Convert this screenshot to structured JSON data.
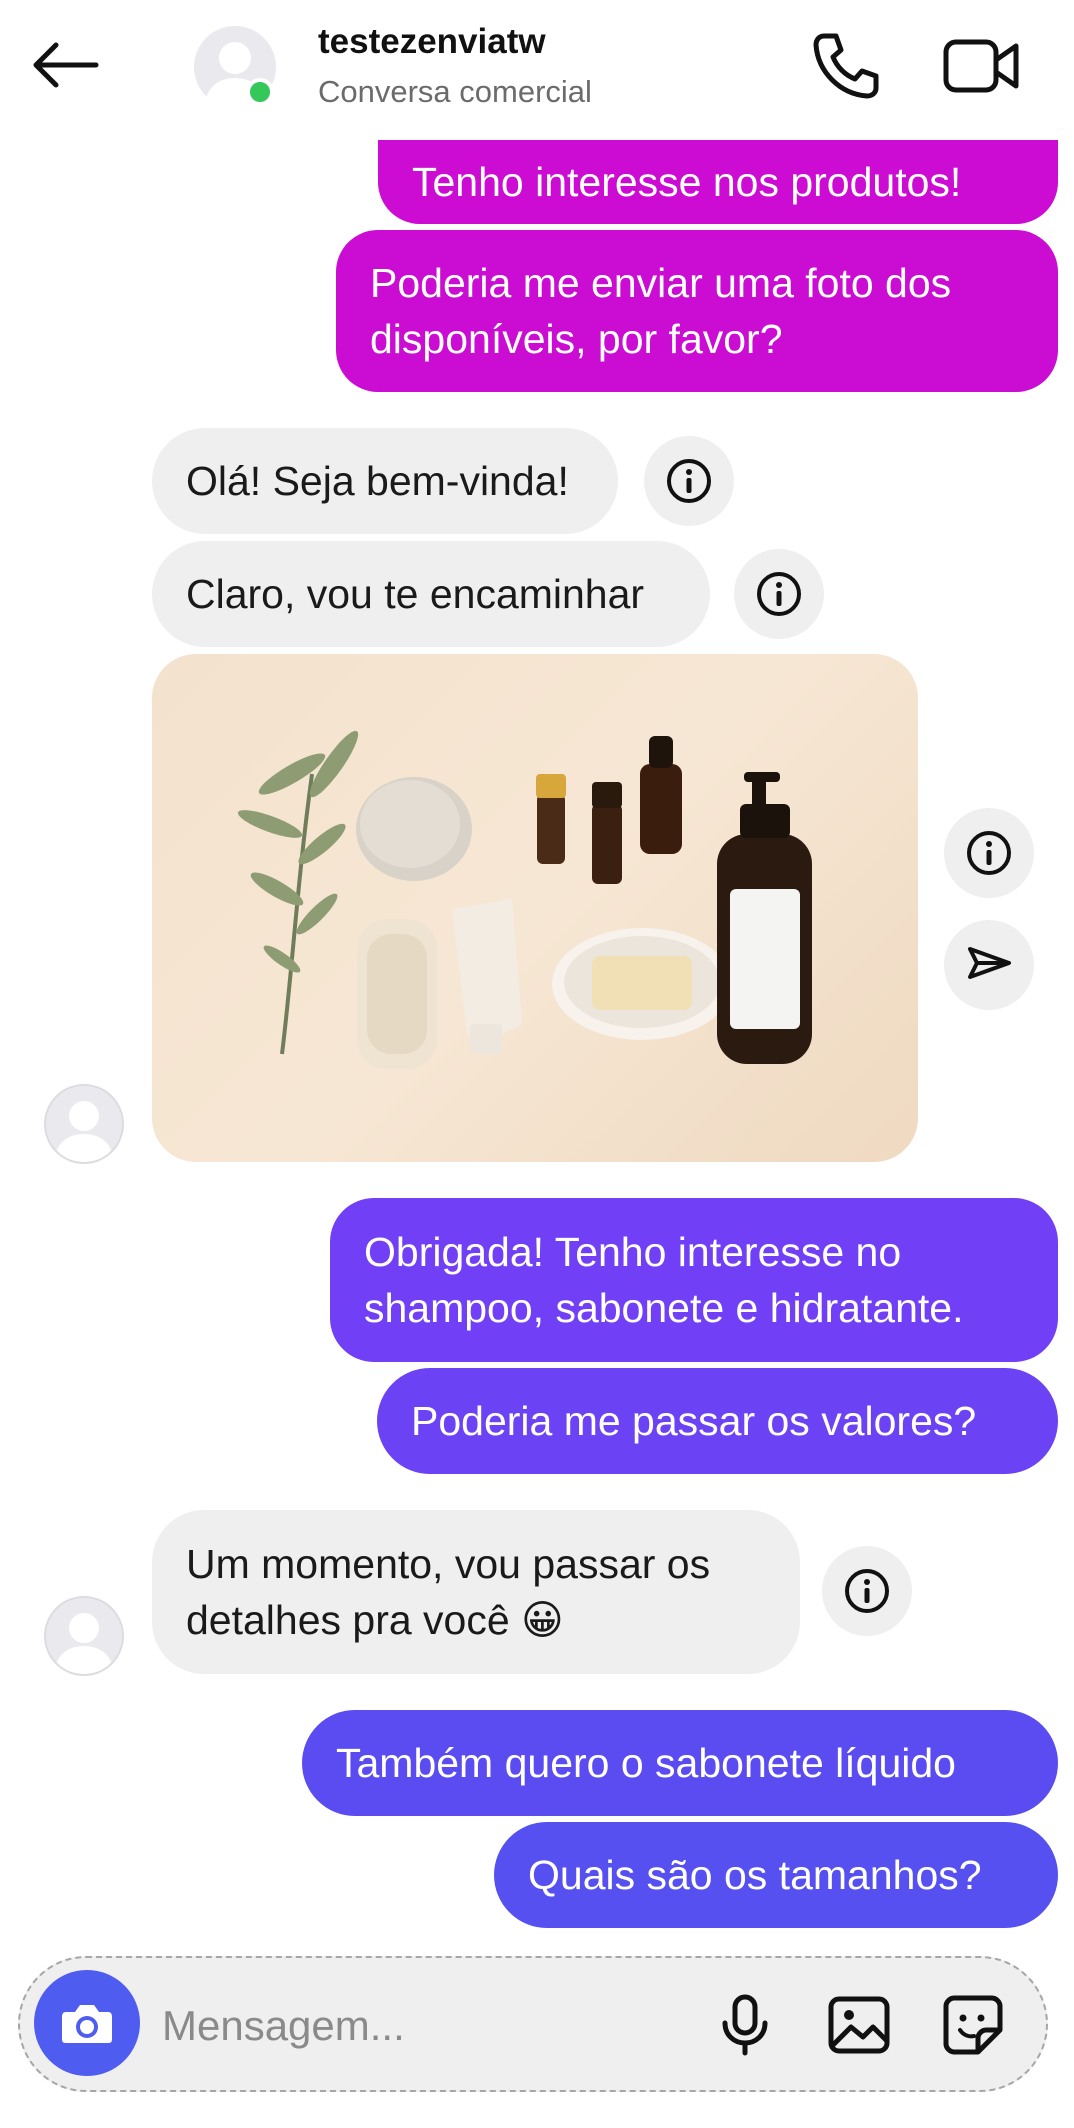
{
  "header": {
    "contact_name": "testezenviatw",
    "contact_subtitle": "Conversa comercial",
    "icons": [
      "back-arrow-icon",
      "phone-icon",
      "video-camera-icon"
    ]
  },
  "messages": [
    {
      "from": "me",
      "text": "Tenho interesse nos produtos!"
    },
    {
      "from": "me",
      "line1": "Poderia me enviar uma foto dos",
      "line2": "disponíveis, por favor?"
    },
    {
      "from": "them",
      "text": "Olá! Seja bem-vinda!"
    },
    {
      "from": "them",
      "text": "Claro, vou te encaminhar"
    },
    {
      "from": "them",
      "type": "image",
      "image_description": "bath and beauty products"
    },
    {
      "from": "me",
      "line1": "Obrigada! Tenho interesse no",
      "line2": "shampoo, sabonete e hidratante."
    },
    {
      "from": "me",
      "text": "Poderia me passar os valores?"
    },
    {
      "from": "them",
      "line1": "Um momento, vou passar os",
      "line2": "detalhes pra você 😀"
    },
    {
      "from": "me",
      "text": "Também quero o sabonete líquido"
    },
    {
      "from": "me",
      "text": "Quais são os tamanhos?"
    }
  ],
  "composer": {
    "placeholder": "Mensagem...",
    "icons": [
      "camera-icon",
      "microphone-icon",
      "gallery-icon",
      "sticker-icon"
    ]
  },
  "colors": {
    "magenta": "#cc0bd3",
    "purple": "#7140f6",
    "indigo": "#5a4cf1",
    "incoming_bg": "#efefef",
    "online": "#34c759",
    "camera_btn": "#4f5cf0"
  }
}
